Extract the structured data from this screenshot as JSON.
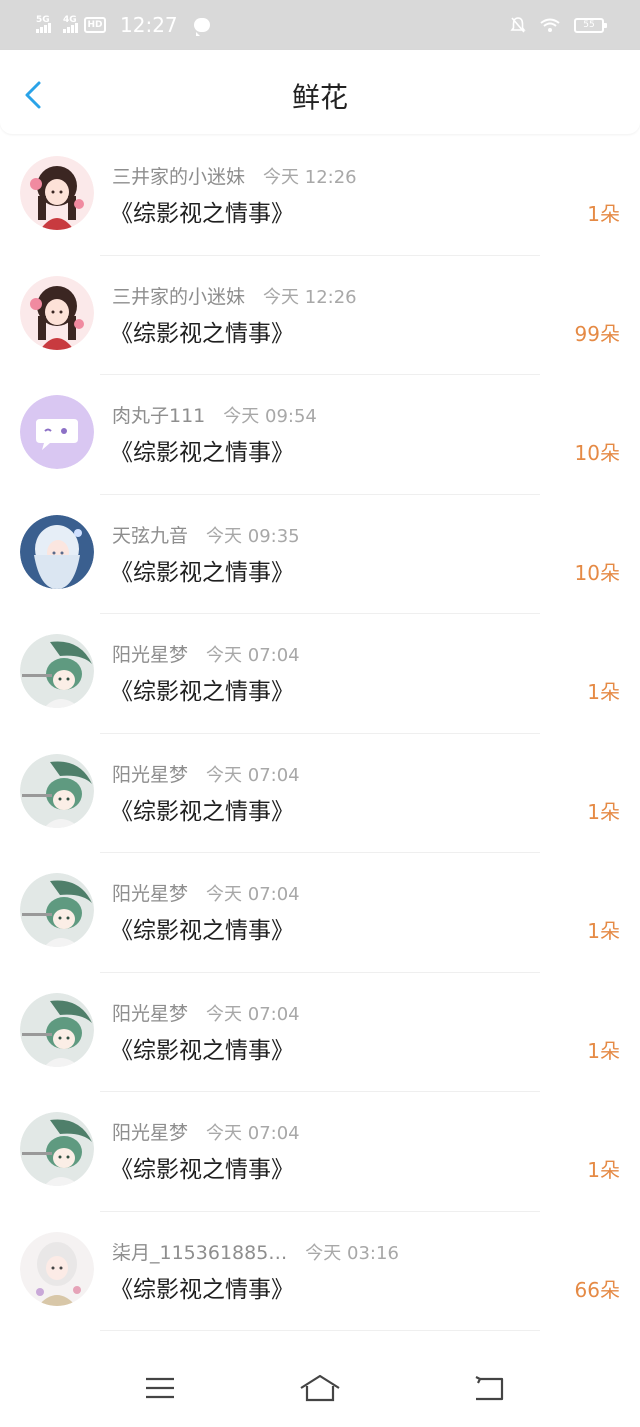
{
  "status_bar": {
    "signal_1_label": "5G",
    "signal_2_label": "4G",
    "hd_label": "HD",
    "time": "12:27",
    "battery": "55",
    "icons": [
      "message-icon",
      "mute-bell-icon",
      "wifi-icon",
      "battery-icon"
    ]
  },
  "header": {
    "title": "鲜花",
    "back_icon": "chevron-left-icon",
    "accent_color": "#2aa3e8"
  },
  "items": [
    {
      "user": "三井家的小迷妹",
      "time": "今天 12:26",
      "book": "《综影视之情事》",
      "count": "1朵",
      "avatar": "anime-girl-red"
    },
    {
      "user": "三井家的小迷妹",
      "time": "今天 12:26",
      "book": "《综影视之情事》",
      "count": "99朵",
      "avatar": "anime-girl-red"
    },
    {
      "user": "肉丸子111",
      "time": "今天 09:54",
      "book": "《综影视之情事》",
      "count": "10朵",
      "avatar": "purple-chat-bubble"
    },
    {
      "user": "天弦九音",
      "time": "今天 09:35",
      "book": "《综影视之情事》",
      "count": "10朵",
      "avatar": "anime-girl-blue"
    },
    {
      "user": "阳光星梦",
      "time": "今天 07:04",
      "book": "《综影视之情事》",
      "count": "1朵",
      "avatar": "anime-green"
    },
    {
      "user": "阳光星梦",
      "time": "今天 07:04",
      "book": "《综影视之情事》",
      "count": "1朵",
      "avatar": "anime-green"
    },
    {
      "user": "阳光星梦",
      "time": "今天 07:04",
      "book": "《综影视之情事》",
      "count": "1朵",
      "avatar": "anime-green"
    },
    {
      "user": "阳光星梦",
      "time": "今天 07:04",
      "book": "《综影视之情事》",
      "count": "1朵",
      "avatar": "anime-green"
    },
    {
      "user": "阳光星梦",
      "time": "今天 07:04",
      "book": "《综影视之情事》",
      "count": "1朵",
      "avatar": "anime-green"
    },
    {
      "user": "柒月_115361885…",
      "time": "今天 03:16",
      "book": "《综影视之情事》",
      "count": "66朵",
      "avatar": "anime-girl-white"
    }
  ],
  "count_color": "#e58a45",
  "nav_bar": {
    "buttons": [
      "menu-icon",
      "home-icon",
      "back-icon"
    ]
  }
}
